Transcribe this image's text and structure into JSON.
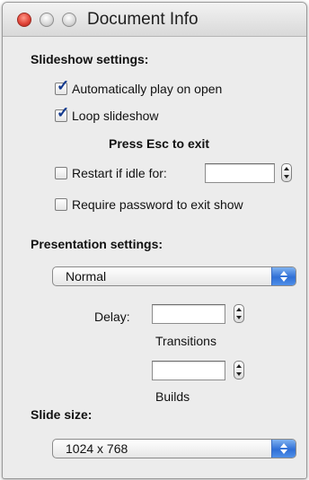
{
  "window": {
    "title": "Document Info"
  },
  "slideshow": {
    "heading": "Slideshow settings:",
    "autoplay_label": "Automatically play on open",
    "autoplay_checked": true,
    "loop_label": "Loop slideshow",
    "loop_checked": true,
    "esc_note": "Press Esc to exit",
    "restart_label": "Restart if idle for:",
    "restart_checked": false,
    "restart_value": "",
    "password_label": "Require password to exit show",
    "password_checked": false
  },
  "presentation": {
    "heading": "Presentation settings:",
    "mode_value": "Normal",
    "delay_label": "Delay:",
    "transitions_value": "",
    "transitions_label": "Transitions",
    "builds_value": "",
    "builds_label": "Builds"
  },
  "slide_size": {
    "heading": "Slide size:",
    "value": "1024 x 768"
  },
  "colors": {
    "accent": "#2f6fd6",
    "check": "#143a8f",
    "window_bg": "#ececec"
  }
}
